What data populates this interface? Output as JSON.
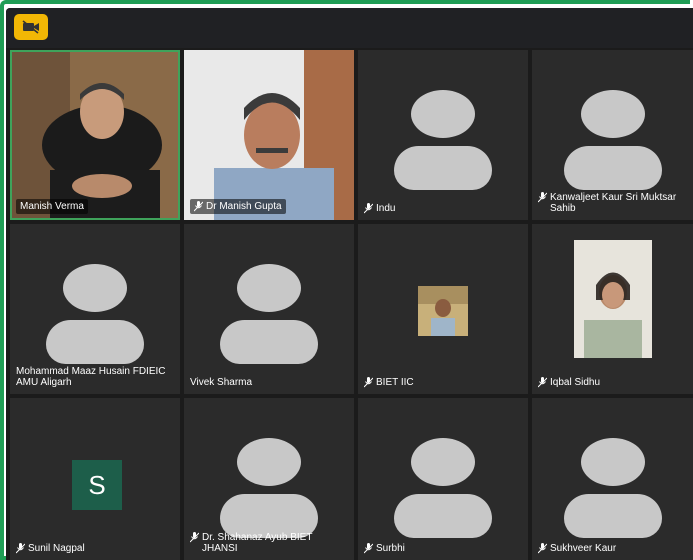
{
  "toolbar": {
    "camera_toggle_icon": "video-off-icon",
    "accent": "#f2b705"
  },
  "participants": [
    {
      "name": "Manish Verma",
      "type": "video-man-1",
      "active": true,
      "muted": false
    },
    {
      "name": "Dr Manish Gupta",
      "type": "video-man-2",
      "muted": true
    },
    {
      "name": "Indu",
      "type": "avatar",
      "muted": true
    },
    {
      "name": "Kanwaljeet Kaur Sri Muktsar Sahib",
      "type": "avatar",
      "muted": true
    },
    {
      "name": "Mohammad Maaz Husain FDIEIC AMU Aligarh",
      "type": "avatar",
      "muted": false
    },
    {
      "name": "Vivek Sharma",
      "type": "avatar",
      "muted": false
    },
    {
      "name": "BIET IIC",
      "type": "small-photo",
      "muted": true
    },
    {
      "name": "Iqbal Sidhu",
      "type": "portrait-woman",
      "muted": true
    },
    {
      "name": "Sunil Nagpal",
      "type": "initial",
      "initial": "S",
      "muted": true
    },
    {
      "name": "Dr. Shahanaz Ayub BIET JHANSI",
      "type": "avatar",
      "muted": true
    },
    {
      "name": "Surbhi",
      "type": "avatar",
      "muted": true
    },
    {
      "name": "Sukhveer Kaur",
      "type": "avatar",
      "muted": true
    }
  ]
}
